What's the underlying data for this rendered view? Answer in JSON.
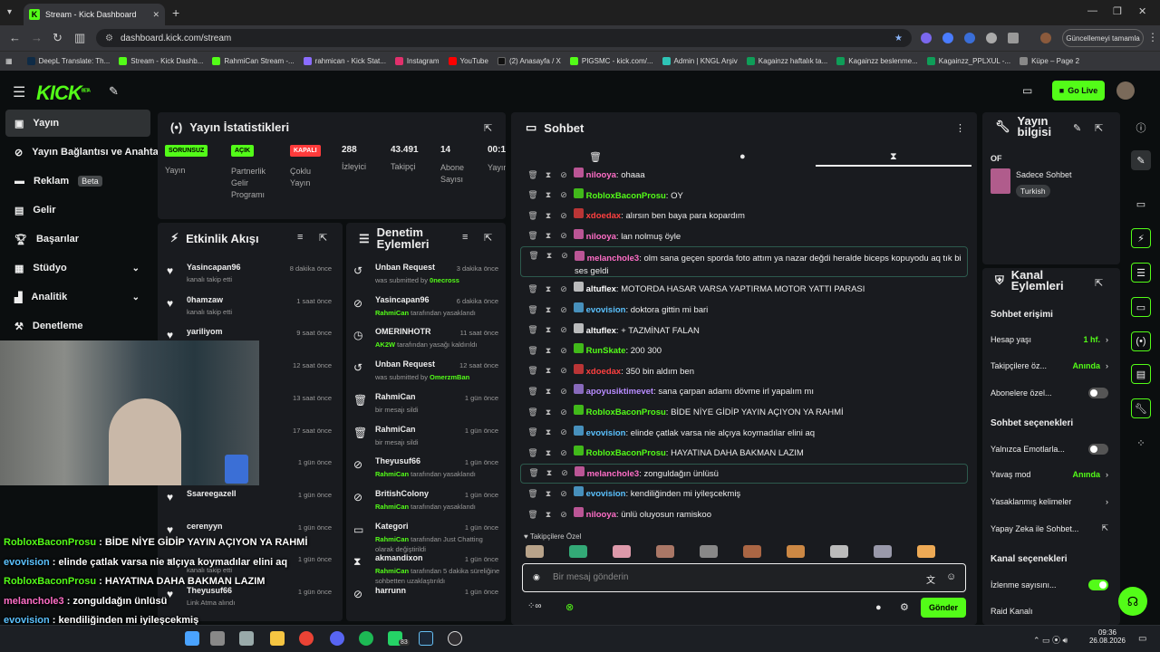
{
  "browser": {
    "tab_title": "Stream - Kick Dashboard",
    "url": "dashboard.kick.com/stream",
    "update_button": "Güncellemeyi tamamla",
    "bookmarks": [
      "DeepL Translate: Th...",
      "Stream - Kick Dashb...",
      "RahmiCan Stream -...",
      "rahmican - Kick Stat...",
      "Instagram",
      "YouTube",
      "(2) Anasayfa / X",
      "PIGSMC - kick.com/...",
      "Admin | KNGL Arşiv",
      "Kagainzz haftalık ta...",
      "Kagainzz beslenme...",
      "Kagainzz_PPLXUL -...",
      "Küpe – Page 2"
    ]
  },
  "header": {
    "logo": "KICK",
    "logo_sup": "BETA",
    "go_live": "Go Live"
  },
  "sidebar": {
    "items": [
      {
        "label": "Yayın"
      },
      {
        "label": "Yayın Bağlantısı ve Anahtarı"
      },
      {
        "label": "Reklam",
        "badge": "Beta"
      },
      {
        "label": "Gelir"
      },
      {
        "label": "Başarılar"
      },
      {
        "label": "Stüdyo"
      },
      {
        "label": "Analitik"
      },
      {
        "label": "Denetleme"
      }
    ]
  },
  "stats": {
    "title": "Yayın İstatistikleri",
    "cols": [
      {
        "badge": "SORUNSUZ",
        "label": "Yayın"
      },
      {
        "badge": "AÇIK",
        "label": "Partnerlik Gelir Programı"
      },
      {
        "badge": "KAPALI",
        "label": "Çoklu Yayın"
      },
      {
        "value": "288",
        "label": "İzleyici"
      },
      {
        "value": "43.491",
        "label": "Takipçi"
      },
      {
        "value": "14",
        "label": "Abone Sayısı"
      },
      {
        "value": "00:10",
        "label": "Yayın Olduğu Süre"
      }
    ]
  },
  "activity": {
    "title": "Etkinlik Akışı",
    "rows": [
      {
        "name": "Yasincapan96",
        "sub": "kanalı takip etti",
        "time": "8 dakika önce"
      },
      {
        "name": "0hamzaw",
        "sub": "kanalı takip etti",
        "time": "1 saat önce"
      },
      {
        "name": "yariliyom",
        "sub": "",
        "time": "9 saat önce"
      },
      {
        "name": "",
        "sub": "",
        "time": "12 saat önce"
      },
      {
        "name": "",
        "sub": "",
        "time": "13 saat önce"
      },
      {
        "name": "",
        "sub": "",
        "time": "17 saat önce"
      },
      {
        "name": "",
        "sub": "",
        "time": "1 gün önce"
      },
      {
        "name": "Ssareegazell",
        "sub": "",
        "time": "1 gün önce"
      },
      {
        "name": "cerenyyn",
        "sub": "",
        "time": "1 gün önce"
      },
      {
        "name": "",
        "sub": "kanalı takip etti",
        "time": "1 gün önce"
      },
      {
        "name": "Theyusuf66",
        "sub": "Link Atma alındı",
        "time": "1 gün önce"
      }
    ]
  },
  "moderation": {
    "title": "Denetim Eylemleri",
    "rows": [
      {
        "name": "Unban Request",
        "sub_pre": "was submitted by ",
        "sub_hl": "0necross",
        "sub_post": "",
        "time": "3 dakika önce"
      },
      {
        "name": "Yasincapan96",
        "sub_pre": "",
        "sub_hl": "RahmiCan",
        "sub_post": " tarafından yasaklandı",
        "time": "6 dakika önce"
      },
      {
        "name": "OMERINHOTR",
        "sub_pre": "",
        "sub_hl": "AK2W",
        "sub_post": " tarafından yasağı kaldırıldı",
        "time": "11 saat önce"
      },
      {
        "name": "Unban Request",
        "sub_pre": "was submitted by ",
        "sub_hl": "OmerzmBan",
        "sub_post": "",
        "time": "12 saat önce"
      },
      {
        "name": "RahmiCan",
        "sub_pre": "bir mesajı sildi",
        "sub_hl": "",
        "sub_post": "",
        "time": "1 gün önce"
      },
      {
        "name": "RahmiCan",
        "sub_pre": "bir mesajı sildi",
        "sub_hl": "",
        "sub_post": "",
        "time": "1 gün önce"
      },
      {
        "name": "Theyusuf66",
        "sub_pre": "",
        "sub_hl": "RahmiCan",
        "sub_post": " tarafından yasaklandı",
        "time": "1 gün önce"
      },
      {
        "name": "BritishColony",
        "sub_pre": "",
        "sub_hl": "RahmiCan",
        "sub_post": " tarafından yasaklandı",
        "time": "1 gün önce"
      },
      {
        "name": "Kategori",
        "sub_pre": "",
        "sub_hl": "RahmiCan",
        "sub_post": " tarafından Just Chatting olarak değiştirildi",
        "time": "1 gün önce"
      },
      {
        "name": "akmandixon",
        "sub_pre": "",
        "sub_hl": "RahmiCan",
        "sub_post": " tarafından 5 dakika süreliğine sohbetten uzaklaştırıldı",
        "time": "1 gün önce"
      },
      {
        "name": "harrunn",
        "sub_pre": "",
        "sub_hl": "",
        "sub_post": "",
        "time": "1 gün önce"
      }
    ]
  },
  "chat": {
    "title": "Sohbet",
    "messages": [
      {
        "user": "nilooya",
        "color": "#ff6ec7",
        "text": "ohaaa"
      },
      {
        "user": "RobloxBaconProsu",
        "color": "#53fc18",
        "text": "OY"
      },
      {
        "user": "xdoedax",
        "color": "#ff4040",
        "text": "alırsın ben baya para kopardım"
      },
      {
        "user": "nilooya",
        "color": "#ff6ec7",
        "text": "lan nolmuş öyle"
      },
      {
        "user": "melanchole3",
        "color": "#ff6ec7",
        "text": "olm sana geçen sporda foto attım ya nazar değdi heralde biceps kopuyodu aq tık bi ses geldi"
      },
      {
        "user": "altuflex",
        "color": "#ffffff",
        "text": "MOTORDA HASAR VARSA YAPTIRMA MOTOR YATTI PARASI"
      },
      {
        "user": "evovision",
        "color": "#5bc2ff",
        "text": "doktora gittin mi bari"
      },
      {
        "user": "altuflex",
        "color": "#ffffff",
        "text": "+ TAZMİNAT FALAN"
      },
      {
        "user": "RunSkate",
        "color": "#53fc18",
        "text": "200 300"
      },
      {
        "user": "xdoedax",
        "color": "#ff4040",
        "text": "350 bin aldım ben"
      },
      {
        "user": "apoyusiktimevet",
        "color": "#b88cff",
        "text": "sana çarpan adamı dövme irl yapalım mı"
      },
      {
        "user": "RobloxBaconProsu",
        "color": "#53fc18",
        "text": "BİDE NİYE GİDİP YAYIN AÇIYON YA RAHMİ"
      },
      {
        "user": "evovision",
        "color": "#5bc2ff",
        "text": "elinde çatlak varsa nie alçıya koymadılar elini aq"
      },
      {
        "user": "RobloxBaconProsu",
        "color": "#53fc18",
        "text": "HAYATINA DAHA BAKMAN LAZIM"
      },
      {
        "user": "melanchole3",
        "color": "#ff6ec7",
        "text": "zonguldağın ünlüsü"
      },
      {
        "user": "evovision",
        "color": "#5bc2ff",
        "text": "kendiliğinden mi iyileşcekmiş"
      },
      {
        "user": "nilooya",
        "color": "#ff6ec7",
        "text": "ünlü oluyosun ramiskoo"
      }
    ],
    "emote_label": "Takipçilere Özel",
    "input_placeholder": "Bir mesaj gönderin",
    "send": "Gönder"
  },
  "stream_info": {
    "title": "Yayın bilgisi",
    "stream_title": "OF",
    "category": "Sadece Sohbet",
    "tag": "Turkish"
  },
  "channel_actions": {
    "title": "Kanal Eylemleri",
    "chat_access": "Sohbet erişimi",
    "account_age": "Hesap yaşı",
    "account_age_val": "1 hf.",
    "followers_only": "Takipçilere öz...",
    "followers_only_val": "Anında",
    "subs_only": "Abonelere özel...",
    "chat_options": "Sohbet seçenekleri",
    "emote_only": "Yalnızca Emotlarla...",
    "slow_mode": "Yavaş mod",
    "slow_mode_val": "Anında",
    "banned_words": "Yasaklanmış kelimeler",
    "ai_chat": "Yapay Zeka ile Sohbet...",
    "channel_options": "Kanal seçenekleri",
    "view_count": "İzlenme sayısını...",
    "raid": "Raid Kanalı"
  },
  "overlay": {
    "lines": [
      {
        "user": "RobloxBaconProsu",
        "color": "#53fc18",
        "text": " : BİDE NİYE GİDİP YAYIN AÇIYON YA RAHMİ"
      },
      {
        "user": "evovision",
        "color": "#5bc2ff",
        "text": " : elinde çatlak varsa nie alçıya koymadılar elini aq"
      },
      {
        "user": "RobloxBaconProsu",
        "color": "#53fc18",
        "text": " : HAYATINA DAHA BAKMAN LAZIM"
      },
      {
        "user": "melanchole3",
        "color": "#ff6ec7",
        "text": " : zonguldağın ünlüsü"
      },
      {
        "user": "evovision",
        "color": "#5bc2ff",
        "text": " : kendiliğinden mi iyileşcekmiş"
      },
      {
        "user": "nilooya",
        "color": "#ff6ec7",
        "text": " : ünlü oluyosun ramiskoo"
      }
    ]
  },
  "taskbar": {
    "time": "09:36",
    "date": "26.08.2026",
    "badge": "83"
  }
}
